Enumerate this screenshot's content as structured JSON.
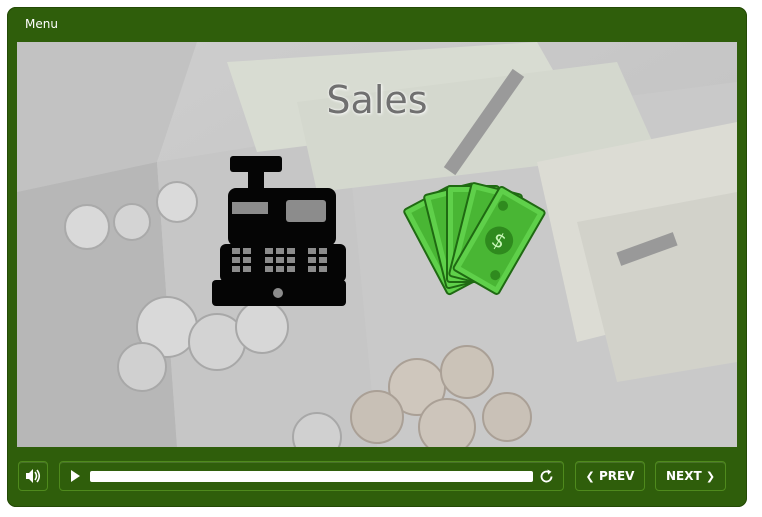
{
  "header": {
    "menu_label": "Menu"
  },
  "slide": {
    "title": "Sales"
  },
  "controls": {
    "volume_icon": "volume-icon",
    "play_icon": "play-icon",
    "replay_icon": "replay-icon",
    "progress": 0.0,
    "prev_label": "PREV",
    "next_label": "NEXT"
  },
  "colors": {
    "frame": "#2f5e0b",
    "button_border": "#4f8a1d",
    "title": "#707070",
    "money_green": "#4cc83a"
  }
}
